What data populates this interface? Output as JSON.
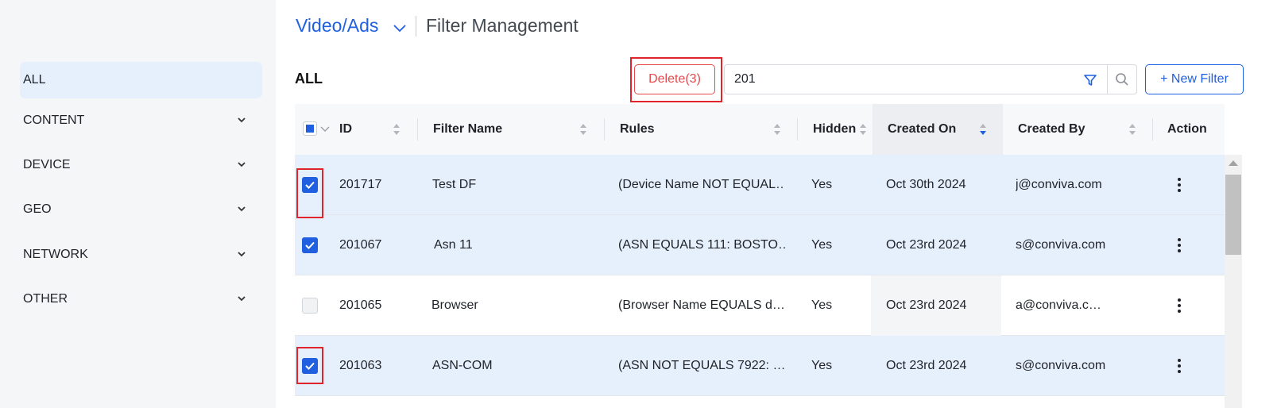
{
  "sidebar": {
    "items": [
      {
        "label": "ALL",
        "active": true
      },
      {
        "label": "CONTENT"
      },
      {
        "label": "DEVICE"
      },
      {
        "label": "GEO"
      },
      {
        "label": "NETWORK"
      },
      {
        "label": "OTHER"
      }
    ]
  },
  "header": {
    "breadcrumb_link": "Video/Ads",
    "page_title": "Filter Management"
  },
  "toolbar": {
    "section_title": "ALL",
    "delete_label": "Delete(3)",
    "search_value": "201",
    "new_filter_label": "+ New Filter"
  },
  "table": {
    "columns": [
      "ID",
      "Filter Name",
      "Rules",
      "Hidden",
      "Created On",
      "Created By",
      "Action"
    ],
    "sorted_column": "Created On",
    "sort_direction": "descending",
    "rows": [
      {
        "id": "201717",
        "name": "Test DF",
        "rules": "(Device Name NOT EQUAL…",
        "hidden": "Yes",
        "created_on": "Oct 30th 2024",
        "created_by": "j@conviva.com",
        "checked": true
      },
      {
        "id": "201067",
        "name": "Asn 11",
        "rules": "(ASN EQUALS 111: BOSTO…",
        "hidden": "Yes",
        "created_on": "Oct 23rd 2024",
        "created_by": "s@conviva.com",
        "checked": true
      },
      {
        "id": "201065",
        "name": "Browser",
        "rules": "(Browser Name EQUALS d…",
        "hidden": "Yes",
        "created_on": "Oct 23rd 2024",
        "created_by": "a@conviva.c…",
        "checked": false
      },
      {
        "id": "201063",
        "name": "ASN-COM",
        "rules": "(ASN NOT EQUALS 7922: …",
        "hidden": "Yes",
        "created_on": "Oct 23rd 2024",
        "created_by": "s@conviva.com",
        "checked": true
      }
    ]
  },
  "colors": {
    "accent": "#1f5fe0",
    "danger": "#e5484d",
    "highlight": "#e0242c",
    "selected_row": "#e6f0fd"
  }
}
